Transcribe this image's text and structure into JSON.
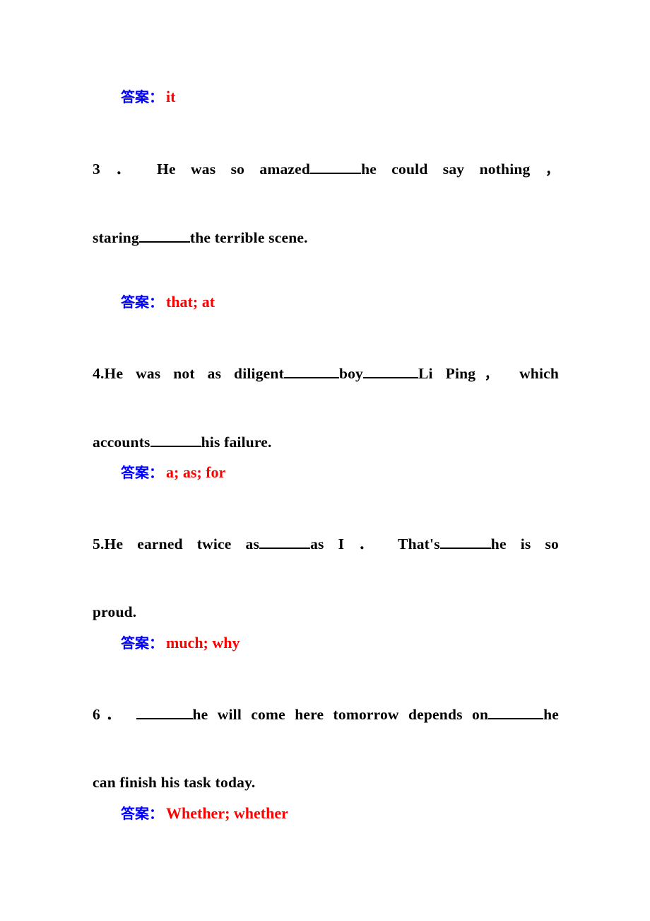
{
  "document": {
    "language": "zh-CN / en",
    "answer_label": "答案：",
    "colors": {
      "answer_label": "#0000FF",
      "answer_value": "#FF0000",
      "body_text": "#000000",
      "page_background": "#FFFFFF"
    }
  },
  "blocks": [
    {
      "type": "answer",
      "label": "答案：",
      "value": "it"
    },
    {
      "type": "question",
      "number": "3 ．",
      "line1_before": "He was so amazed",
      "line1_after": "he could say nothing",
      "line1_end_punct": "，",
      "line2_before": "staring",
      "line2_after": "the terrible scene.",
      "full_text": "3．He was so amazed________he could say nothing，staring________the terrible scene."
    },
    {
      "type": "answer",
      "label": "答案：",
      "value": "that; at"
    },
    {
      "type": "question",
      "number": "4.",
      "line1_before": "He was not as diligent",
      "line1_mid": "boy",
      "line1_after": "Li Ping",
      "line1_punct": "，",
      "line1_tail": "which",
      "line2_before": "accounts",
      "line2_after": "his failure.",
      "full_text": "4.He was not as diligent________boy________Li Ping，which accounts________his failure."
    },
    {
      "type": "answer",
      "label": "答案：",
      "value": "a; as; for"
    },
    {
      "type": "question",
      "number": "5.",
      "line1_before": "He earned twice as",
      "line1_mid": "as I ．",
      "line1_after2": "That's",
      "line1_tail": "he is so",
      "line2": "proud.",
      "full_text": "5.He earned twice as________as I ． That's________he is so proud."
    },
    {
      "type": "answer",
      "label": "答案：",
      "value": "much; why"
    },
    {
      "type": "question",
      "number": "6．",
      "line1_after": "he will come here tomorrow depends on",
      "line1_tail": "he",
      "line2": "can finish his task today.",
      "full_text": "6．________he will come here tomorrow depends on________he can finish his task today."
    },
    {
      "type": "answer",
      "label": "答案：",
      "value": "Whether; whether"
    }
  ]
}
